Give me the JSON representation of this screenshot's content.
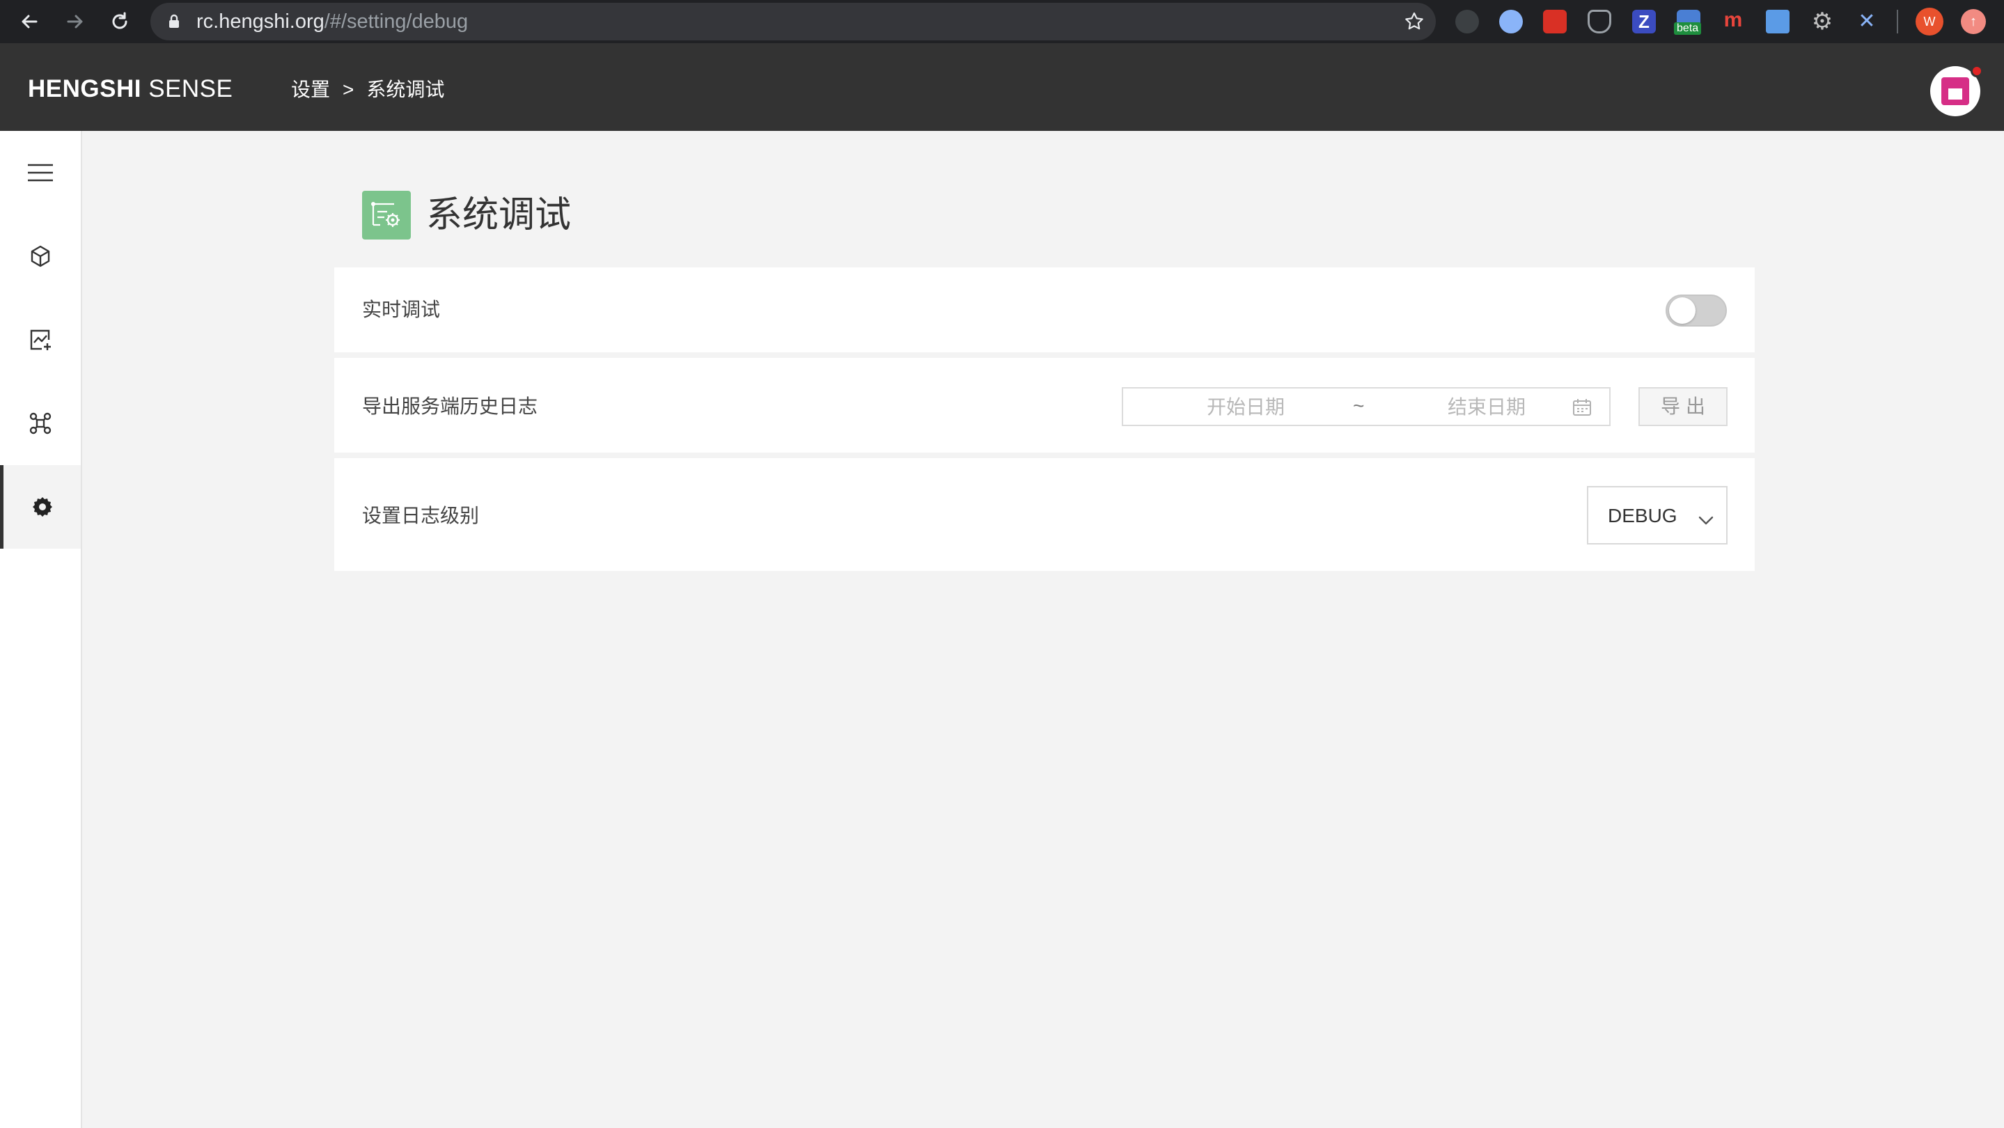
{
  "browser": {
    "url_host": "rc.hengshi.org",
    "url_path": "/#/setting/debug",
    "profile_initial": "W",
    "extension_badge": "beta"
  },
  "header": {
    "logo_bold": "HENGSHI",
    "logo_light": "SENSE",
    "breadcrumb": [
      "设置",
      "系统调试"
    ],
    "breadcrumb_sep": ">"
  },
  "sidebar": {
    "items": [
      {
        "icon": "menu-icon"
      },
      {
        "icon": "cube-icon"
      },
      {
        "icon": "chart-add-icon"
      },
      {
        "icon": "network-icon"
      },
      {
        "icon": "gear-icon",
        "active": true
      }
    ]
  },
  "page": {
    "title": "系统调试"
  },
  "settings": {
    "realtime_debug": {
      "label": "实时调试",
      "enabled": false
    },
    "export_logs": {
      "label": "导出服务端历史日志",
      "start_placeholder": "开始日期",
      "range_sep": "~",
      "end_placeholder": "结束日期",
      "button": "导出"
    },
    "log_level": {
      "label": "设置日志级别",
      "value": "DEBUG"
    }
  },
  "colors": {
    "header_bg": "#333333",
    "title_icon_bg": "#7cc48c",
    "avatar_accent": "#d62e86"
  }
}
